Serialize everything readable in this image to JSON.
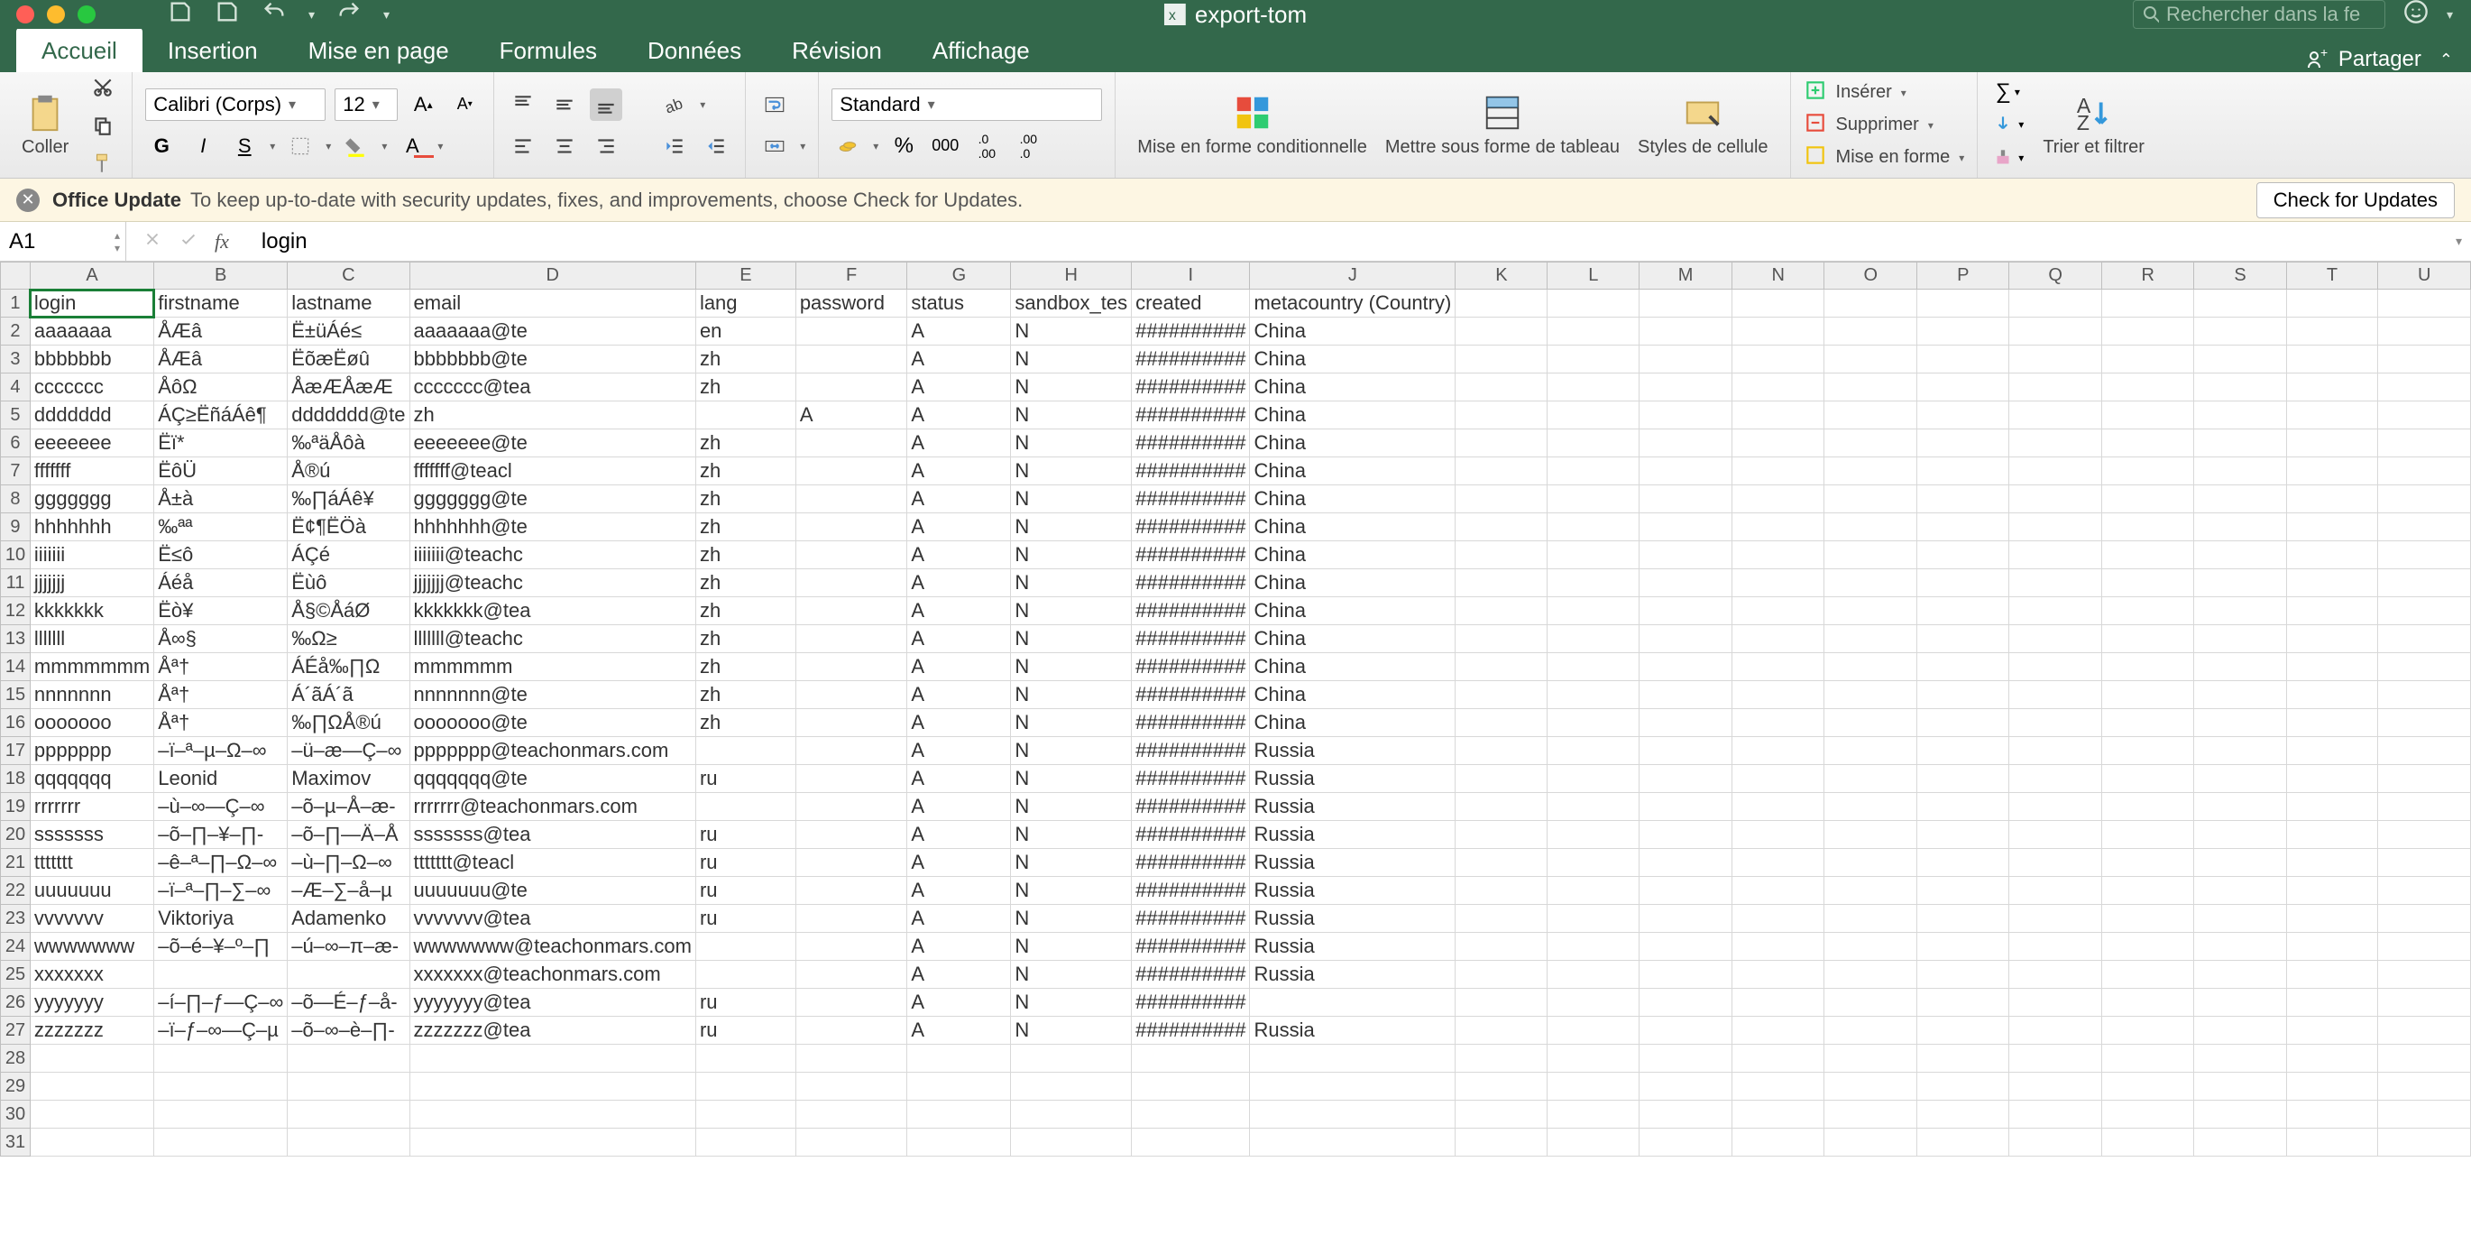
{
  "title": "export-tom",
  "search_placeholder": "Rechercher dans la fe",
  "tabs": [
    "Accueil",
    "Insertion",
    "Mise en page",
    "Formules",
    "Données",
    "Révision",
    "Affichage"
  ],
  "share_label": "Partager",
  "ribbon": {
    "paste_label": "Coller",
    "font_name": "Calibri (Corps)",
    "font_size": "12",
    "bold": "G",
    "italic": "I",
    "underline": "S",
    "number_format": "Standard",
    "cond_fmt": "Mise en forme conditionnelle",
    "as_table": "Mettre sous forme de tableau",
    "cell_styles": "Styles de cellule",
    "insert": "Insérer",
    "delete": "Supprimer",
    "format": "Mise en forme",
    "sort": "Trier et filtrer"
  },
  "update": {
    "title": "Office Update",
    "msg": "To keep up-to-date with security updates, fixes, and improvements, choose Check for Updates.",
    "btn": "Check for Updates"
  },
  "namebox": "A1",
  "formula": "login",
  "columns": [
    "A",
    "B",
    "C",
    "D",
    "E",
    "F",
    "G",
    "H",
    "I",
    "J",
    "K",
    "L",
    "M",
    "N",
    "O",
    "P",
    "Q",
    "R",
    "S",
    "T",
    "U"
  ],
  "headers": [
    "login",
    "firstname",
    "lastname",
    "email",
    "lang",
    "password",
    "status",
    "sandbox_tes",
    "created",
    "metacountry (Country)"
  ],
  "rows": [
    [
      "aaaaaaa",
      "ÅÆâ",
      "Ë±üÁé≤",
      "aaaaaaa@te",
      "en",
      "",
      "A",
      "N",
      "##########",
      "China"
    ],
    [
      "bbbbbbb",
      "ÅÆâ",
      "ËõæËøû",
      "bbbbbbb@te",
      "zh",
      "",
      "A",
      "N",
      "##########",
      "China"
    ],
    [
      "ccccccc",
      "ÅôΩ",
      "ÅæÆÅæÆ",
      "ccccccc@tea",
      "zh",
      "",
      "A",
      "N",
      "##########",
      "China"
    ],
    [
      "ddddddd",
      "ÁÇ≥ËñáÁê¶",
      "ddddddd@te",
      "zh",
      "",
      "A",
      "A",
      "N",
      "##########",
      "China"
    ],
    [
      "eeeeeee",
      "Ëï*",
      "‰ªäÅôà",
      "eeeeeee@te",
      "zh",
      "",
      "A",
      "N",
      "##########",
      "China"
    ],
    [
      "fffffff",
      "ËôÜ",
      "Å®ú",
      "fffffff@teacl",
      "zh",
      "",
      "A",
      "N",
      "##########",
      "China"
    ],
    [
      "ggggggg",
      "Å±à",
      "‰∏áÁê¥",
      "ggggggg@te",
      "zh",
      "",
      "A",
      "N",
      "##########",
      "China"
    ],
    [
      "hhhhhhh",
      "‰ªª",
      "Ë¢¶ËÖà",
      "hhhhhhh@te",
      "zh",
      "",
      "A",
      "N",
      "##########",
      "China"
    ],
    [
      "iiiiiii",
      "Ë≤ô",
      "ÁÇé",
      "iiiiiii@teachc",
      "zh",
      "",
      "A",
      "N",
      "##########",
      "China"
    ],
    [
      "jjjjjjj",
      "Áéå",
      "Ëùô",
      "jjjjjjj@teachc",
      "zh",
      "",
      "A",
      "N",
      "##########",
      "China"
    ],
    [
      "kkkkkkk",
      "Ëò¥",
      "Å§©ÅáØ",
      "kkkkkkk@tea",
      "zh",
      "",
      "A",
      "N",
      "##########",
      "China"
    ],
    [
      "lllllll",
      "Å∞§",
      "‰Ω≥",
      "lllllll@teachc",
      "zh",
      "",
      "A",
      "N",
      "##########",
      "China"
    ],
    [
      "mmmmmmm",
      "Åª†",
      "ÁÉå‰∏Ω",
      "mmmmmm",
      "zh",
      "",
      "A",
      "N",
      "##########",
      "China"
    ],
    [
      "nnnnnnn",
      "Åª†",
      "Á´ãÁ´ã",
      "nnnnnnn@te",
      "zh",
      "",
      "A",
      "N",
      "##########",
      "China"
    ],
    [
      "ooooooo",
      "Åª†",
      "‰∏ΩÅ®ú",
      "ooooooo@te",
      "zh",
      "",
      "A",
      "N",
      "##########",
      "China"
    ],
    [
      "ppppppp",
      "–ï–ª–µ–Ω–∞",
      "–ü–æ—Ç–∞",
      "ppppppp@teachonmars.com",
      "",
      "",
      "A",
      "N",
      "##########",
      "Russia"
    ],
    [
      "qqqqqqq",
      "Leonid",
      "Maximov",
      "qqqqqqq@te",
      "ru",
      "",
      "A",
      "N",
      "##########",
      "Russia"
    ],
    [
      "rrrrrrr",
      "–ù–∞—Ç–∞",
      "–õ–µ–Å–æ-",
      "rrrrrrr@teachonmars.com",
      "",
      "",
      "A",
      "N",
      "##########",
      "Russia"
    ],
    [
      "sssssss",
      "–õ–∏–¥–∏-",
      "–õ–∏—Ä–Å",
      "sssssss@tea",
      "ru",
      "",
      "A",
      "N",
      "##########",
      "Russia"
    ],
    [
      "ttttttt",
      "–ê–ª–∏–Ω–∞",
      "–ù–∏–Ω–∞",
      "ttttttt@teacl",
      "ru",
      "",
      "A",
      "N",
      "##########",
      "Russia"
    ],
    [
      "uuuuuuu",
      "–ï–ª–∏–∑–∞",
      "–Æ–∑–å–µ",
      "uuuuuuu@te",
      "ru",
      "",
      "A",
      "N",
      "##########",
      "Russia"
    ],
    [
      "vvvvvvv",
      "Viktoriya",
      "Adamenko",
      "vvvvvvv@tea",
      "ru",
      "",
      "A",
      "N",
      "##########",
      "Russia"
    ],
    [
      "wwwwwww",
      "–õ–é–¥–º–∏",
      "–ú–∞–π–æ-",
      "wwwwwww@teachonmars.com",
      "",
      "",
      "A",
      "N",
      "##########",
      "Russia"
    ],
    [
      "xxxxxxx",
      "",
      "",
      "xxxxxxx@teachonmars.com",
      "",
      "",
      "A",
      "N",
      "##########",
      "Russia"
    ],
    [
      "yyyyyyy",
      "–í–∏–ƒ—Ç–∞",
      "–õ—É–ƒ–å-",
      "yyyyyyy@tea",
      "ru",
      "",
      "A",
      "N",
      "##########",
      ""
    ],
    [
      "zzzzzzz",
      "–ï–ƒ–∞—Ç–µ",
      "–õ–∞–è–∏-",
      "zzzzzzz@tea",
      "ru",
      "",
      "A",
      "N",
      "##########",
      "Russia"
    ]
  ],
  "empty_rows": [
    28,
    29,
    30,
    31
  ]
}
